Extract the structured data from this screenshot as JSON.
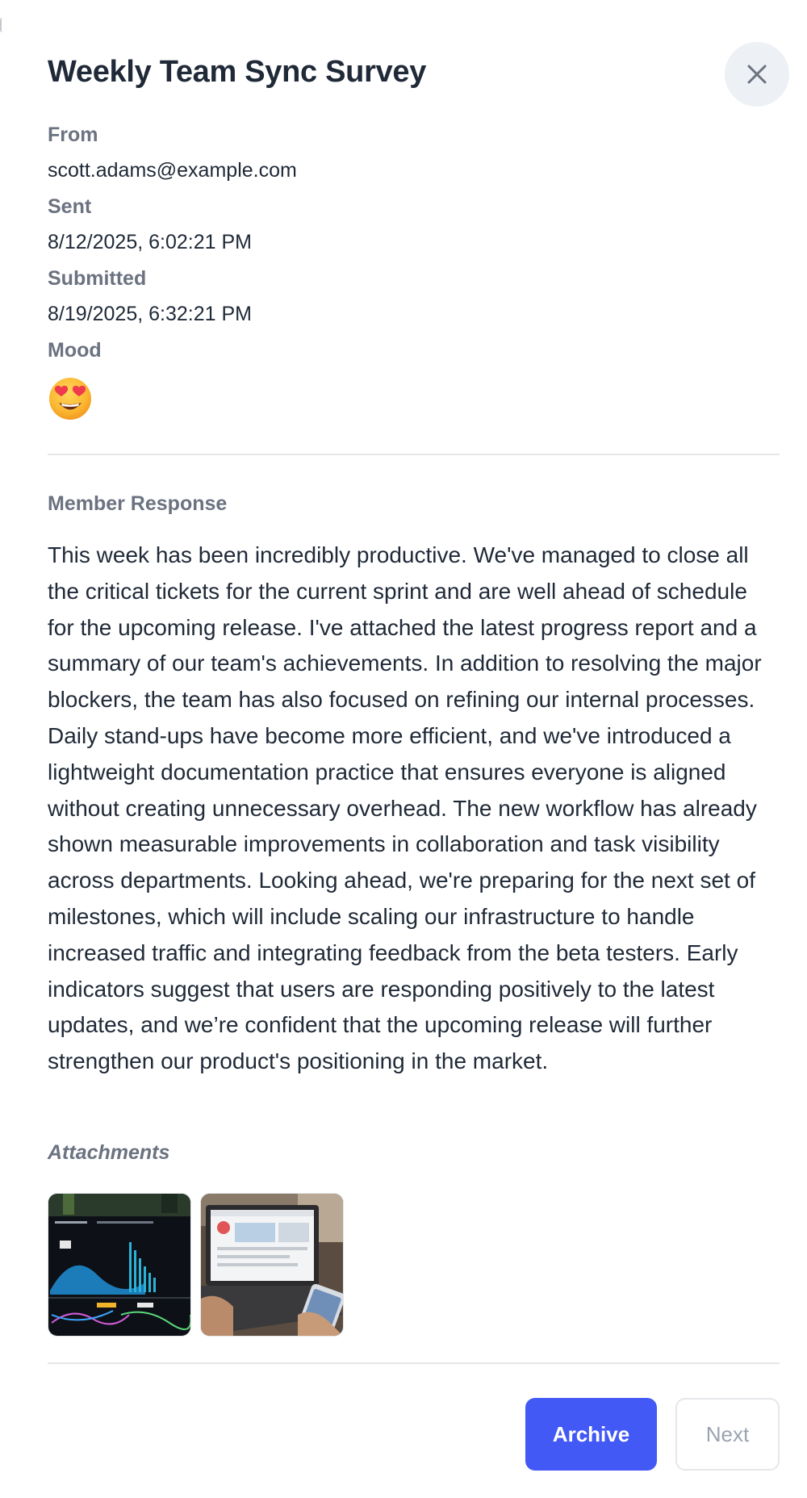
{
  "dialog": {
    "title": "Weekly Team Sync Survey",
    "close_icon": "close-icon"
  },
  "meta": {
    "from_label": "From",
    "from_value": "scott.adams@example.com",
    "sent_label": "Sent",
    "sent_value": "8/12/2025, 6:02:21 PM",
    "submitted_label": "Submitted",
    "submitted_value": "8/19/2025, 6:32:21 PM",
    "mood_label": "Mood",
    "mood_icon": "heart-eyes-emoji-icon"
  },
  "response": {
    "label": "Member Response",
    "text": "This week has been incredibly productive. We've managed to close all the critical tickets for the current sprint and are well ahead of schedule for the upcoming release. I've attached the latest progress report and a summary of our team's achievements. In addition to resolving the major blockers, the team has also focused on refining our internal processes. Daily stand-ups have become more efficient, and we've introduced a lightweight documentation practice that ensures everyone is aligned without creating unnecessary overhead. The new workflow has already shown measurable improvements in collaboration and task visibility across departments. Looking ahead, we're preparing for the next set of milestones, which will include scaling our infrastructure to handle increased traffic and integrating feedback from the beta testers. Early indicators suggest that users are responding positively to the latest updates, and we’re confident that the upcoming release will further strengthen our product's positioning in the market."
  },
  "attachments": {
    "label": "Attachments",
    "items": [
      {
        "icon": "dashboard-screenshot-thumbnail"
      },
      {
        "icon": "laptop-photo-thumbnail"
      }
    ]
  },
  "actions": {
    "archive_label": "Archive",
    "next_label": "Next"
  },
  "colors": {
    "accent": "#4259f5",
    "muted_label": "#6b7280",
    "text": "#1f2937",
    "divider": "#e5e7eb"
  }
}
